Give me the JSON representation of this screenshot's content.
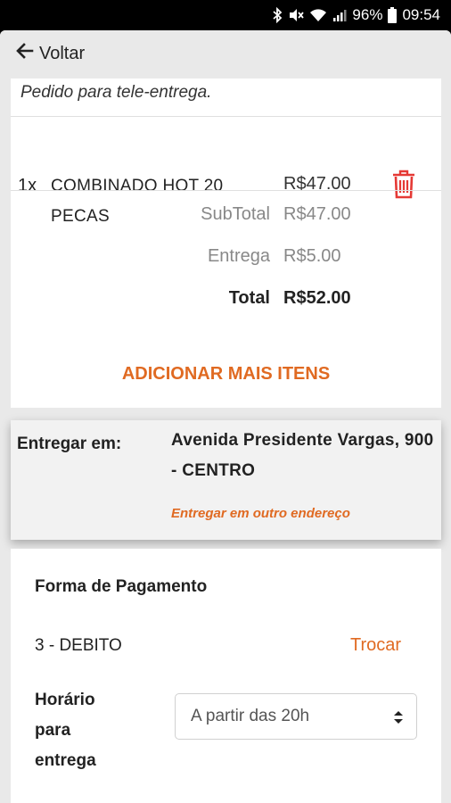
{
  "status_bar": {
    "battery": "96%",
    "time": "09:54"
  },
  "topbar": {
    "back_label": "Voltar"
  },
  "order": {
    "note": "Pedido para tele-entrega.",
    "items": [
      {
        "qty": "1x",
        "name": "COMBINADO HOT 20 PECAS",
        "price": "R$47.00"
      }
    ],
    "subtotal_label": "SubTotal",
    "subtotal_value": "R$47.00",
    "delivery_label": "Entrega",
    "delivery_value": "R$5.00",
    "total_label": "Total",
    "total_value": "R$52.00",
    "add_more_label": "ADICIONAR MAIS ITENS"
  },
  "delivery": {
    "label": "Entregar em:",
    "address": "Avenida Presidente Vargas, 900 - CENTRO",
    "other_address_link": "Entregar em outro endereço"
  },
  "payment": {
    "title": "Forma de Pagamento",
    "method": "3 - DEBITO",
    "swap_label": "Trocar",
    "time_label": "Horário para entrega",
    "time_selected": "A partir das 20h"
  },
  "colors": {
    "accent": "#e06a22",
    "delete": "#e53935"
  }
}
